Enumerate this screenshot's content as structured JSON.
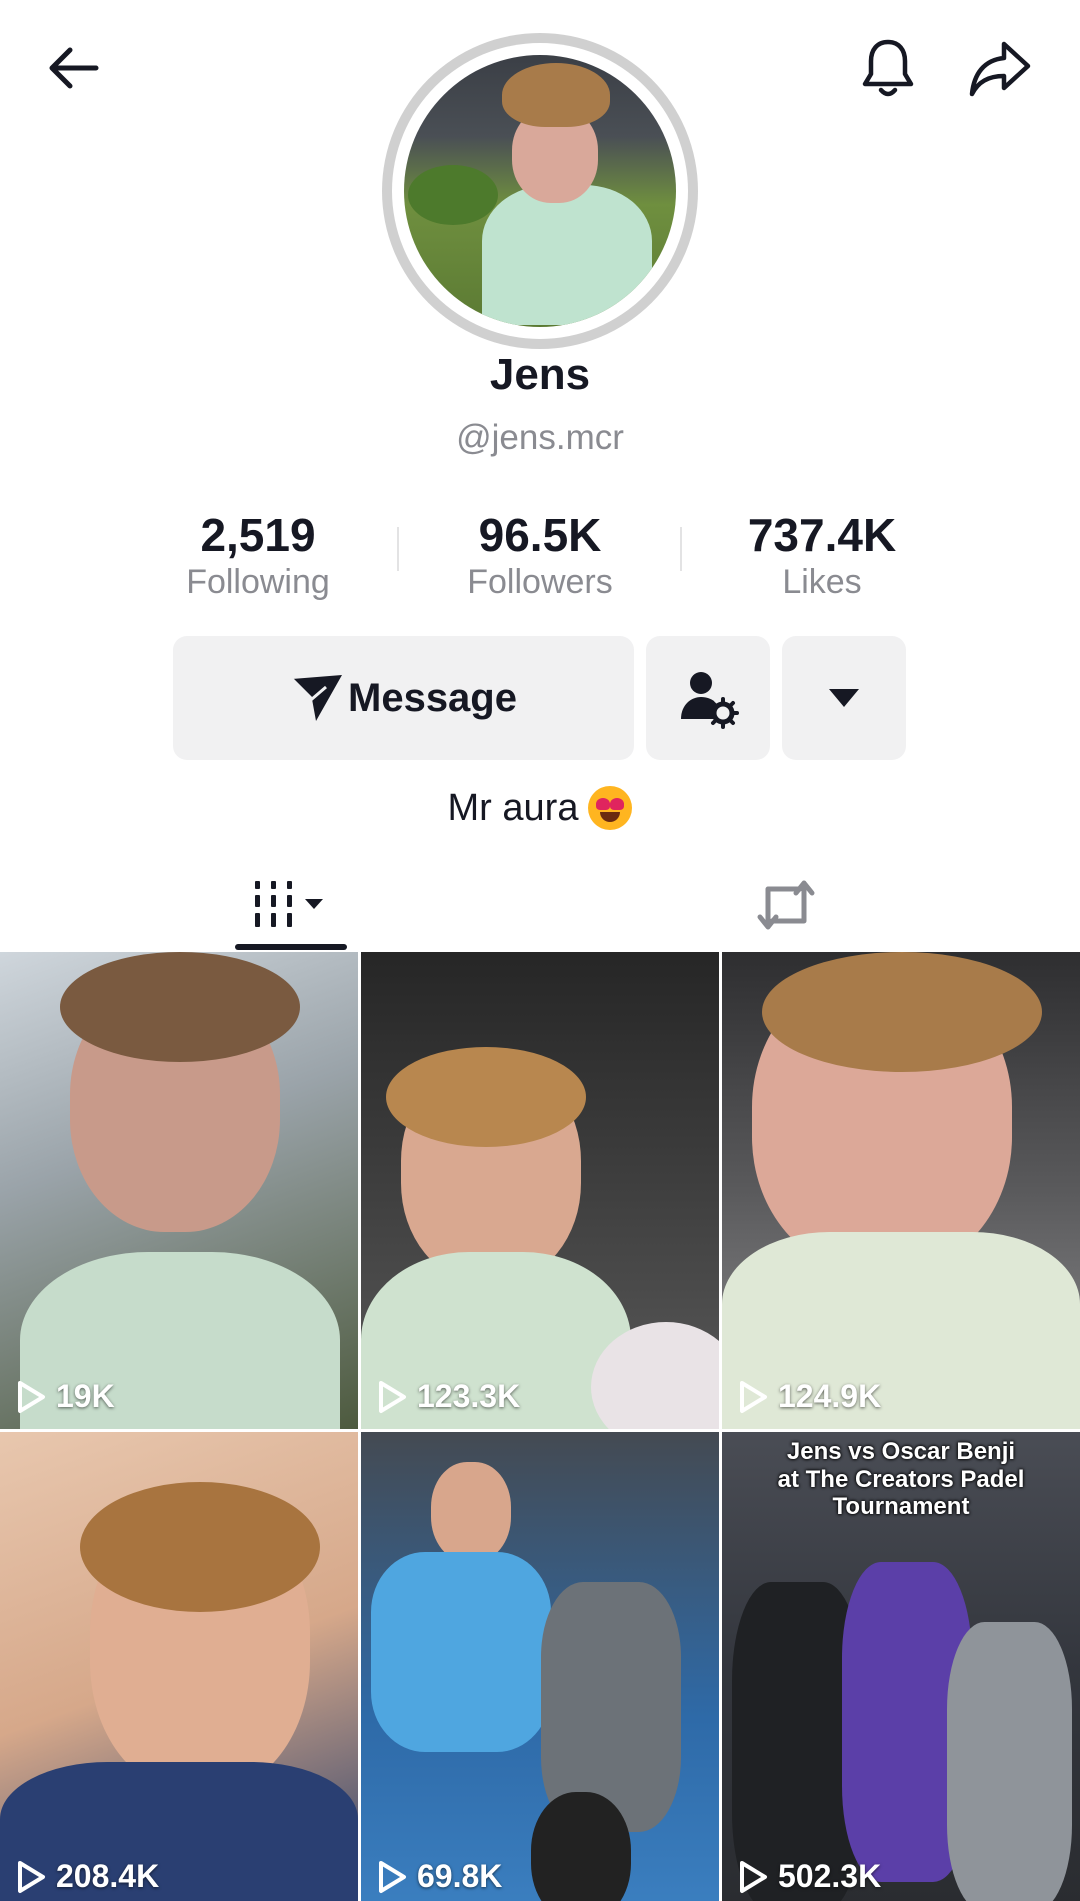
{
  "header": {
    "back_icon": "arrow-left-icon",
    "bell_icon": "bell-icon",
    "share_icon": "share-arrow-icon"
  },
  "profile": {
    "name": "Jens",
    "handle": "@jens.mcr",
    "bio": "Mr aura"
  },
  "stats": [
    {
      "value": "2,519",
      "label": "Following"
    },
    {
      "value": "96.5K",
      "label": "Followers"
    },
    {
      "value": "737.4K",
      "label": "Likes"
    }
  ],
  "actions": {
    "message_label": "Message",
    "message_icon": "send-icon",
    "user_settings_icon": "user-gear-icon",
    "more_icon": "caret-down-icon"
  },
  "tabs": {
    "videos_icon": "grid-icon",
    "reposts_icon": "repost-icon"
  },
  "videos": [
    {
      "views": "19K",
      "caption": ""
    },
    {
      "views": "123.3K",
      "caption": ""
    },
    {
      "views": "124.9K",
      "caption": ""
    },
    {
      "views": "208.4K",
      "caption": ""
    },
    {
      "views": "69.8K",
      "caption": ""
    },
    {
      "views": "502.3K",
      "caption": "Jens vs Oscar Benji\nat The Creators Padel\nTournament"
    }
  ]
}
